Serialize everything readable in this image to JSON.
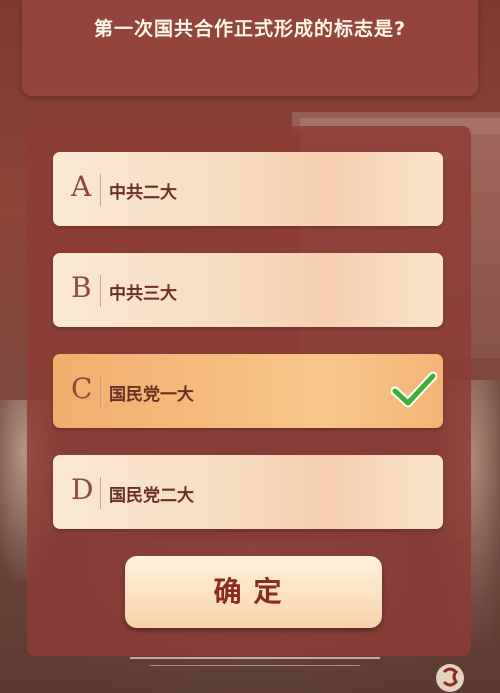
{
  "question": {
    "text": "第一次国共合作正式形成的标志是?"
  },
  "options": [
    {
      "letter": "A",
      "label": "中共二大",
      "selected": false
    },
    {
      "letter": "B",
      "label": "中共三大",
      "selected": false
    },
    {
      "letter": "C",
      "label": "国民党一大",
      "selected": true
    },
    {
      "letter": "D",
      "label": "国民党二大",
      "selected": false
    }
  ],
  "confirm": {
    "label": "确定"
  },
  "colors": {
    "background": "#8c4537",
    "option_bg": "#fbe9d4",
    "option_selected_bg": "#f4bb7e",
    "check": "#3fae3a",
    "confirm_text": "#8b2a1f"
  },
  "icons": {
    "check": "check-icon",
    "emblem": "emblem-icon"
  }
}
